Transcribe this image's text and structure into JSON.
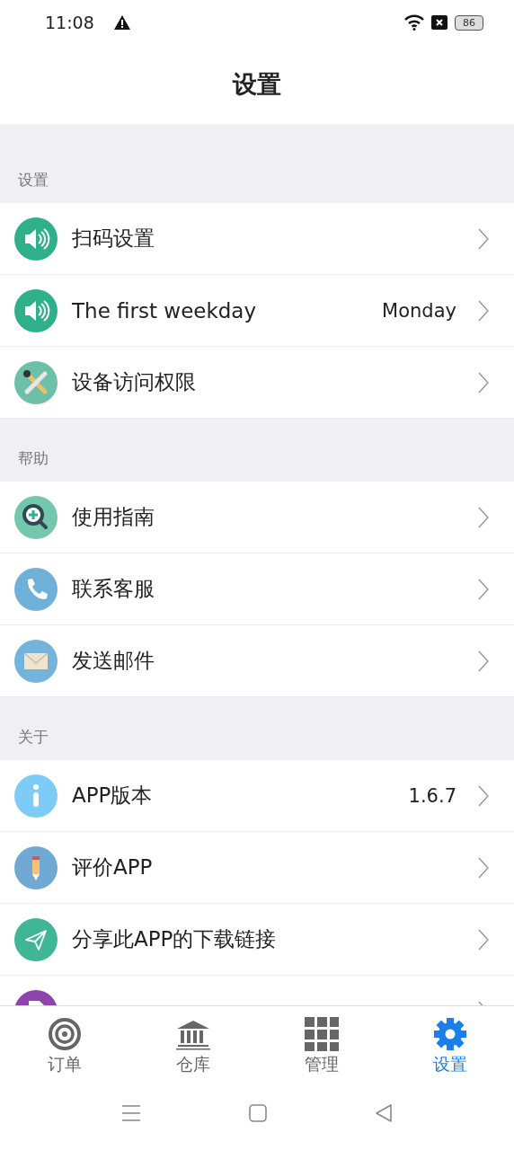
{
  "status_bar": {
    "time": "11:08",
    "battery": "86"
  },
  "header": {
    "title": "设置"
  },
  "sections": [
    {
      "title": "设置",
      "items": [
        {
          "label": "扫码设置",
          "kind": "speaker"
        },
        {
          "label": "The first weekday",
          "value": "Monday",
          "kind": "speaker"
        },
        {
          "label": "设备访问权限",
          "kind": "tools"
        }
      ]
    },
    {
      "title": "帮助",
      "items": [
        {
          "label": "使用指南",
          "kind": "zoom"
        },
        {
          "label": "联系客服",
          "kind": "phone"
        },
        {
          "label": "发送邮件",
          "kind": "mail"
        }
      ]
    },
    {
      "title": "关于",
      "items": [
        {
          "label": "APP版本",
          "value": "1.6.7",
          "kind": "info"
        },
        {
          "label": "评价APP",
          "kind": "pencil"
        },
        {
          "label": "分享此APP的下载链接",
          "kind": "send"
        },
        {
          "kind": "doc"
        }
      ]
    }
  ],
  "tabs": [
    {
      "label": "订单",
      "kind": "target",
      "selected": false
    },
    {
      "label": "仓库",
      "kind": "bank",
      "selected": false
    },
    {
      "label": "管理",
      "kind": "grid",
      "selected": false
    },
    {
      "label": "设置",
      "kind": "gear",
      "selected": true
    }
  ]
}
